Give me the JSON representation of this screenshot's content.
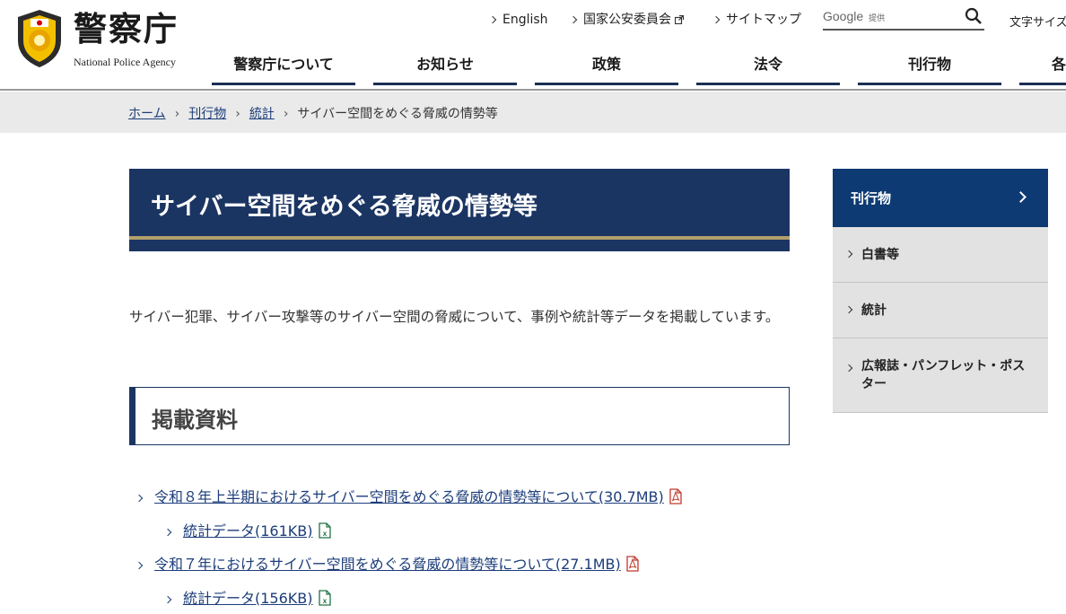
{
  "header": {
    "logo_title": "警察庁",
    "logo_subtitle": "National Police Agency",
    "util_links": [
      {
        "label": "English"
      },
      {
        "label": "国家公安委員会"
      },
      {
        "label": "サイトマップ"
      }
    ],
    "search": {
      "brand": "Google",
      "brand_note": "提供",
      "placeholder": ""
    },
    "font_size_label": "文字サイズ",
    "nav": [
      {
        "label": "警察庁について"
      },
      {
        "label": "お知らせ"
      },
      {
        "label": "政策"
      },
      {
        "label": "法令"
      },
      {
        "label": "刊行物"
      },
      {
        "label": "各"
      }
    ]
  },
  "breadcrumb": [
    {
      "label": "ホーム"
    },
    {
      "label": "刊行物"
    },
    {
      "label": "統計"
    },
    {
      "label": "サイバー空間をめぐる脅威の情勢等"
    }
  ],
  "main": {
    "title": "サイバー空間をめぐる脅威の情勢等",
    "lead": "サイバー犯罪、サイバー攻撃等のサイバー空間の脅威について、事例や統計等データを掲載しています。",
    "section_title": "掲載資料",
    "documents": [
      {
        "label": "令和８年上半期におけるサイバー空間をめぐる脅威の情勢等について(30.7MB)",
        "type": "pdf",
        "sub": {
          "label": "統計データ(161KB)",
          "type": "xls"
        }
      },
      {
        "label": "令和７年におけるサイバー空間をめぐる脅威の情勢等について(27.1MB)",
        "type": "pdf",
        "sub": {
          "label": "統計データ(156KB)",
          "type": "xls"
        }
      }
    ]
  },
  "sidebar": {
    "heading": "刊行物",
    "items": [
      {
        "label": "白書等"
      },
      {
        "label": "統計"
      },
      {
        "label": "広報誌・パンフレット・ポスター"
      }
    ]
  },
  "colors": {
    "navy": "#1b3563",
    "side_navy": "#0d3a73",
    "gold": "#b29f6b",
    "link": "#1c3d7a"
  }
}
